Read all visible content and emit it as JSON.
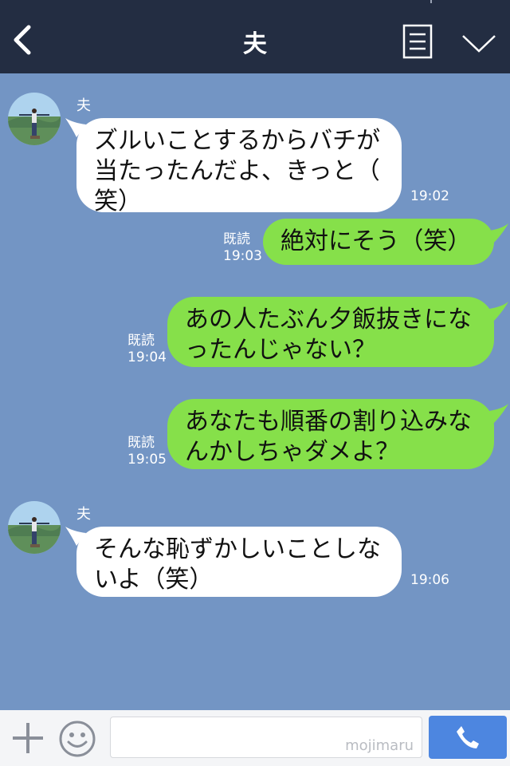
{
  "header": {
    "title": "夫",
    "icons": [
      "back-arrow-icon",
      "note-icon",
      "chevron-down-icon"
    ],
    "background": "#232d42"
  },
  "chat": {
    "background": "#7395c4",
    "messages": [
      {
        "sender": "夫",
        "direction": "in",
        "lines": [
          "ズルいことするからバチが",
          "当たったんだよ、きっと（",
          "笑）"
        ],
        "time": "19:02"
      },
      {
        "direction": "out",
        "read": "既読",
        "lines": [
          "絶対にそう（笑）"
        ],
        "time": "19:03"
      },
      {
        "direction": "out",
        "read": "既読",
        "lines": [
          "あの人たぶん夕飯抜きにな",
          "ったんじゃない？"
        ],
        "time": "19:04"
      },
      {
        "direction": "out",
        "read": "既読",
        "lines": [
          "あなたも順番の割り込みな",
          "んかしちゃダメよ？"
        ],
        "time": "19:05"
      },
      {
        "sender": "夫",
        "direction": "in",
        "lines": [
          "そんな恥ずかしいことしな",
          "いよ（笑）"
        ],
        "time": "19:06"
      }
    ]
  },
  "input_bar": {
    "watermark": "mojimaru",
    "icons": [
      "plus-icon",
      "emoji-icon",
      "phone-icon"
    ],
    "call_color": "#4d86e0"
  },
  "colors": {
    "incoming_bubble": "#ffffff",
    "outgoing_bubble": "#86e04a"
  }
}
